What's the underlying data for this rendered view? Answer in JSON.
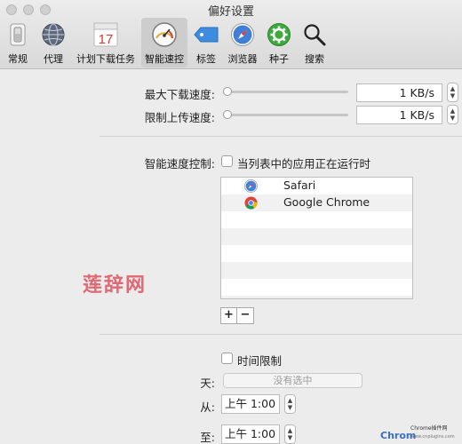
{
  "window": {
    "title": "偏好设置"
  },
  "toolbar": {
    "tabs": [
      {
        "label": "常规",
        "icon": "general-switch-icon"
      },
      {
        "label": "代理",
        "icon": "globe-icon"
      },
      {
        "label": "计划下载任务",
        "icon": "calendar-icon",
        "calendar_day": "17"
      },
      {
        "label": "智能速控",
        "icon": "speedometer-icon"
      },
      {
        "label": "标签",
        "icon": "tag-icon"
      },
      {
        "label": "浏览器",
        "icon": "compass-icon"
      },
      {
        "label": "种子",
        "icon": "gear-icon"
      },
      {
        "label": "搜索",
        "icon": "magnifier-icon"
      }
    ],
    "active_tab": "智能速控"
  },
  "speed": {
    "max_download_label": "最大下载速度:",
    "max_download_value": "1 KB/s",
    "max_download_level": 0,
    "max_upload_label": "限制上传速度:",
    "max_upload_value": "1 KB/s",
    "max_upload_level": 0
  },
  "smart_control": {
    "label": "智能速度控制:",
    "app_running_checkbox_label": "当列表中的应用正在运行时",
    "app_running_checked": false,
    "apps": [
      {
        "name": "Safari",
        "icon": "safari-icon"
      },
      {
        "name": "Google Chrome",
        "icon": "chrome-icon"
      }
    ],
    "add_label": "+",
    "remove_label": "−"
  },
  "schedule": {
    "time_limit_label": "时间限制",
    "time_limit_checked": false,
    "days_label": "天:",
    "days_value": "没有选中",
    "from_label": "从:",
    "from_value": "上午  1:00",
    "to_label": "至:",
    "to_value": "上午  1:00"
  },
  "watermarks": {
    "center": "莲辞网",
    "corner_brand": "Chrom",
    "corner_small": "Chrome插件网",
    "corner_url": "www.cnplugins.com"
  },
  "colors": {
    "accent_active_tab": "#cdcdcd",
    "watermark_red": "#e0525f",
    "brand_blue": "#3a6fc1"
  }
}
